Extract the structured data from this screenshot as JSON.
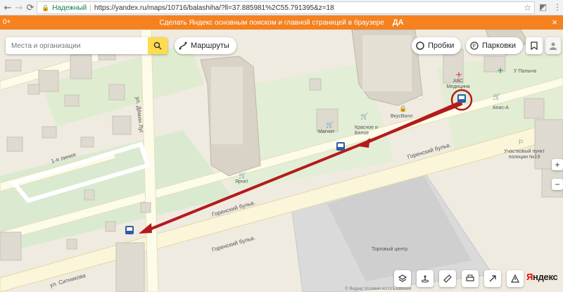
{
  "browser": {
    "secure_label": "Надежный",
    "url": "https://yandex.ru/maps/10716/balashiha/?ll=37.885981%2C55.791395&z=18"
  },
  "promo": {
    "age": "0+",
    "text": "Сделать Яндекс основным поиском и главной страницей в браузере",
    "action": "ДА"
  },
  "search": {
    "placeholder": "Места и организации"
  },
  "buttons": {
    "routes": "Маршруты",
    "traffic": "Пробки",
    "parking": "Парковки"
  },
  "streets": {
    "demin_lug": "ул. Дёмин Луг",
    "first_line": "1-я линия",
    "gorensky_1": "Горенский бульв.",
    "gorensky_2": "Горенский бульв.",
    "gorensky_3": "Горенский бульв.",
    "sitnikova": "ул. Ситникова"
  },
  "pois": {
    "magnit": "Магнит",
    "krasnoe_beloe": "Красное и Белое",
    "vkusvill": "ВкусВилл",
    "yarche": "Ярче!",
    "abc_med": "АВС Медицина",
    "apis": "Апис-А",
    "u_palycha": "У Палыча",
    "police": "Участковый пункт полиции №19",
    "mall": "Торговый центр"
  },
  "logo": {
    "first": "Я",
    "rest": "ндекс"
  },
  "copyright": "© Яндекс Условия использования"
}
